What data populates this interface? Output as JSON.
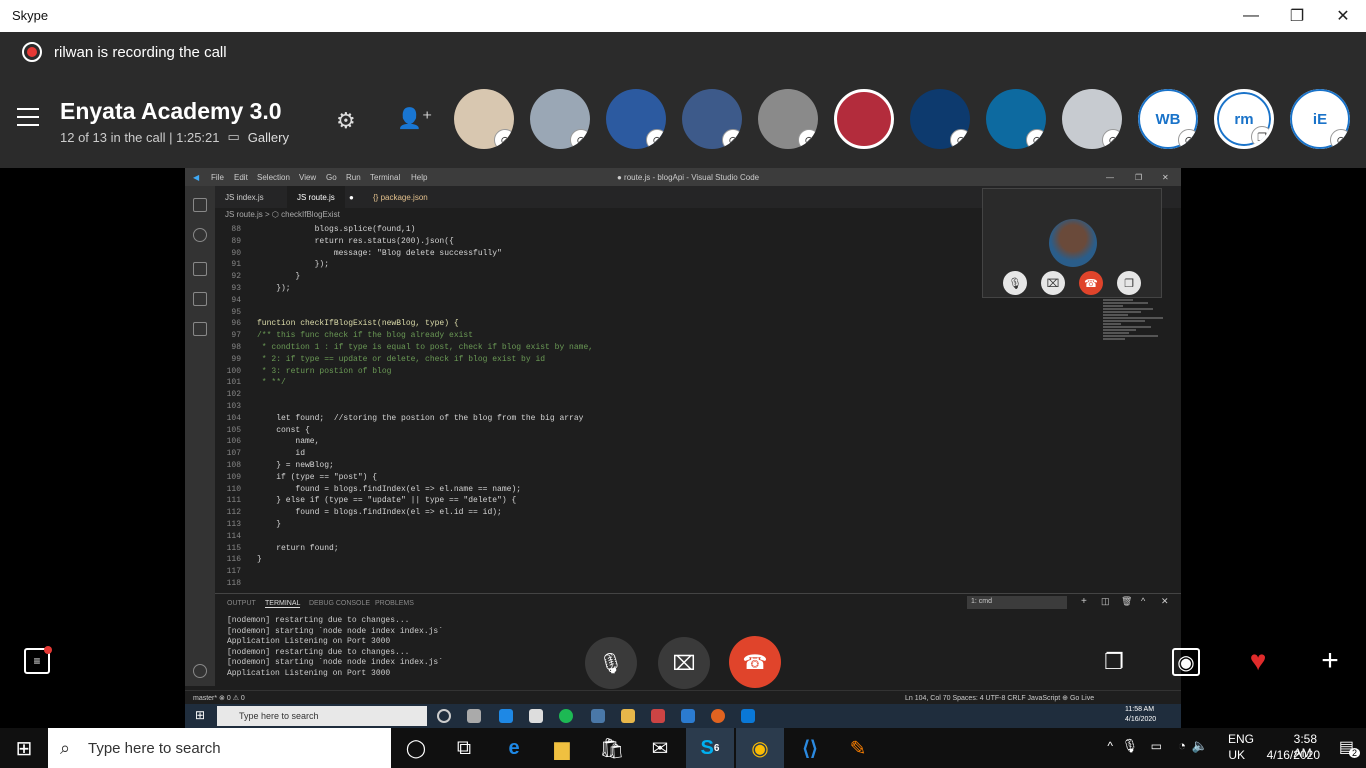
{
  "window": {
    "title": "Skype"
  },
  "recording": {
    "text": "rilwan is recording the call"
  },
  "call": {
    "name": "Enyata Academy 3.0",
    "status": "12 of 13 in the call | 1:25:21",
    "view": "Gallery"
  },
  "participants": [
    {
      "initials": "",
      "color": "#d8c7b0"
    },
    {
      "initials": "",
      "color": "#9aa7b5"
    },
    {
      "initials": "",
      "color": "#2c5aa0"
    },
    {
      "initials": "",
      "color": "#3d5a8a"
    },
    {
      "initials": "",
      "color": "#8a8a8a"
    },
    {
      "initials": "",
      "color": "#b32c3c"
    },
    {
      "initials": "",
      "color": "#0d3a6e"
    },
    {
      "initials": "",
      "color": "#0d6aa0"
    },
    {
      "initials": "",
      "color": "#c7cbd0"
    },
    {
      "initials": "WB",
      "color": "#ffffff"
    },
    {
      "initials": "rm",
      "color": "#ffffff"
    },
    {
      "initials": "iE",
      "color": "#ffffff"
    }
  ],
  "vscode": {
    "menu": [
      "File",
      "Edit",
      "Selection",
      "View",
      "Go",
      "Run",
      "Terminal",
      "Help"
    ],
    "window_title": "● route.js - blogApi - Visual Studio Code",
    "tabs": [
      "JS index.js",
      "JS route.js",
      "{} package.json"
    ],
    "breadcrumb": "JS route.js > ⬡ checkIfBlogExist",
    "code_lines": [
      {
        "n": "88",
        "t": "            blogs.splice(found,1)"
      },
      {
        "n": "89",
        "t": "            return res.status(200).json({"
      },
      {
        "n": "90",
        "t": "                message: \"Blog delete successfully\""
      },
      {
        "n": "91",
        "t": "            });"
      },
      {
        "n": "92",
        "t": "        }"
      },
      {
        "n": "93",
        "t": "    });"
      },
      {
        "n": "94",
        "t": ""
      },
      {
        "n": "95",
        "t": ""
      },
      {
        "n": "96",
        "t": "function checkIfBlogExist(newBlog, type) {"
      },
      {
        "n": "97",
        "t": "/** this func check if the blog already exist"
      },
      {
        "n": "98",
        "t": " * condtion 1 : if type is equal to post, check if blog exist by name,"
      },
      {
        "n": "99",
        "t": " * 2: if type == update or delete, check if blog exist by id"
      },
      {
        "n": "100",
        "t": " * 3: return postion of blog"
      },
      {
        "n": "101",
        "t": " * **/"
      },
      {
        "n": "102",
        "t": ""
      },
      {
        "n": "103",
        "t": ""
      },
      {
        "n": "104",
        "t": "    let found;  //storing the postion of the blog from the big array"
      },
      {
        "n": "105",
        "t": "    const {"
      },
      {
        "n": "106",
        "t": "        name,"
      },
      {
        "n": "107",
        "t": "        id"
      },
      {
        "n": "108",
        "t": "    } = newBlog;"
      },
      {
        "n": "109",
        "t": "    if (type == \"post\") {"
      },
      {
        "n": "110",
        "t": "        found = blogs.findIndex(el => el.name == name);"
      },
      {
        "n": "111",
        "t": "    } else if (type == \"update\" || type == \"delete\") {"
      },
      {
        "n": "112",
        "t": "        found = blogs.findIndex(el => el.id == id);"
      },
      {
        "n": "113",
        "t": "    }"
      },
      {
        "n": "114",
        "t": ""
      },
      {
        "n": "115",
        "t": "    return found;"
      },
      {
        "n": "116",
        "t": "}"
      },
      {
        "n": "117",
        "t": ""
      },
      {
        "n": "118",
        "t": ""
      }
    ],
    "panel_tabs": [
      "OUTPUT",
      "TERMINAL",
      "DEBUG CONSOLE",
      "PROBLEMS"
    ],
    "terminal_select": "1: cmd",
    "terminal_lines": [
      "[nodemon] restarting due to changes...",
      "[nodemon] starting `node node index index.js`",
      "Application Listening on Port 3000",
      "[nodemon] restarting due to changes...",
      "[nodemon] starting `node node index index.js`",
      "Application Listening on Port 3000"
    ],
    "status_left": "master* ⊗ 0 ⚠ 0",
    "status_right": "Ln 104, Col 70   Spaces: 4   UTF-8   CRLF   JavaScript   ⊕ Go Live",
    "inner_search": "Type here to search",
    "inner_time": "11:58 AM",
    "inner_date": "4/16/2020"
  },
  "taskbar": {
    "search_placeholder": "Type here to search",
    "skype_badge": "6",
    "lang_top": "ENG",
    "lang_bottom": "UK",
    "time": "3:58 AM",
    "date": "4/16/2020",
    "notif_count": "2"
  }
}
